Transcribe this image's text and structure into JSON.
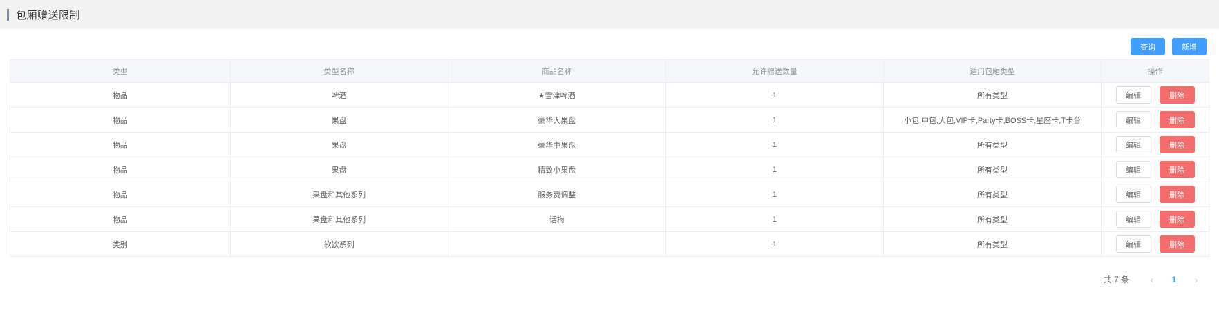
{
  "header": {
    "title": "包厢赠送限制"
  },
  "toolbar": {
    "query_label": "查询",
    "add_label": "新增"
  },
  "table": {
    "headers": [
      "类型",
      "类型名称",
      "商品名称",
      "允许赠送数量",
      "适用包厢类型",
      "操作"
    ],
    "rows": [
      [
        "物品",
        "啤酒",
        "★雪津啤酒",
        "1",
        "所有类型"
      ],
      [
        "物品",
        "果盘",
        "豪华大果盘",
        "1",
        "小包,中包,大包,VIP卡,Party卡,BOSS卡,星座卡,T卡台"
      ],
      [
        "物品",
        "果盘",
        "豪华中果盘",
        "1",
        "所有类型"
      ],
      [
        "物品",
        "果盘",
        "精致小果盘",
        "1",
        "所有类型"
      ],
      [
        "物品",
        "果盘和其他系列",
        "服务费调整",
        "1",
        "所有类型"
      ],
      [
        "物品",
        "果盘和其他系列",
        "话梅",
        "1",
        "所有类型"
      ],
      [
        "类别",
        "软饮系列",
        "",
        "1",
        "所有类型"
      ]
    ],
    "edit_label": "编辑",
    "delete_label": "删除"
  },
  "pagination": {
    "total_text": "共 7 条",
    "current_page": "1",
    "prev_icon": "‹",
    "next_icon": "›"
  }
}
